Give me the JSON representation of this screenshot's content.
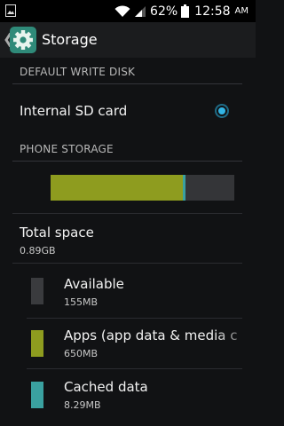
{
  "status_bar": {
    "battery": "62%",
    "time": "12:58",
    "ampm": "AM",
    "icons": [
      "image-icon",
      "wifi-icon",
      "signal-icon",
      "battery-icon"
    ]
  },
  "action_bar": {
    "title": "Storage",
    "back_icon": "chevron-left-icon",
    "app_icon": "gear-icon"
  },
  "sections": {
    "default_write_disk": "DEFAULT WRITE DISK",
    "phone_storage": "PHONE STORAGE"
  },
  "write_disk_option": {
    "label": "Internal SD card",
    "selected": true
  },
  "storage_bar": {
    "apps_fraction": 0.72,
    "cached_fraction": 0.015,
    "available_fraction": 0.265
  },
  "total": {
    "label": "Total space",
    "value": "0.89GB"
  },
  "items": [
    {
      "label": "Available",
      "value": "155MB",
      "color": "#3a3b3e"
    },
    {
      "label": "Apps (app data & media c",
      "value": "650MB",
      "color": "#8e9c1f"
    },
    {
      "label": "Cached data",
      "value": "8.29MB",
      "color": "#3aa1a0"
    }
  ],
  "colors": {
    "accent": "#33b5e5",
    "apps": "#8e9c1f",
    "cached": "#3aa1a0",
    "available": "#343538"
  }
}
